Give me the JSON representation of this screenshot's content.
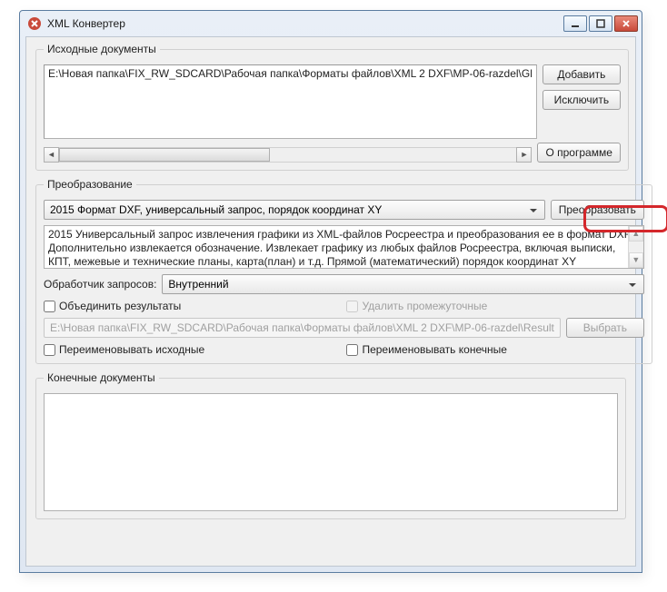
{
  "window": {
    "title": "XML Конвертер"
  },
  "source": {
    "legend": "Исходные документы",
    "path": "E:\\Новая папка\\FIX_RW_SDCARD\\Рабочая папка\\Форматы файлов\\XML 2 DXF\\MP-06-razdel\\Gl",
    "add": "Добавить",
    "remove": "Исключить",
    "about": "О программе"
  },
  "transform": {
    "legend": "Преобразование",
    "format": "2015 Формат DXF, универсальный запрос, порядок координат XY",
    "convert": "Преобразовать",
    "desc": "2015 Универсальный запрос извлечения графики из XML-файлов Росреестра и преобразования ее в формат DXF. Дополнительно извлекается обозначение. Извлекает графику из любых файлов Росреестра, включая выписки, КПТ, межевые и технические планы, карта(план) и т.д. Прямой (математический) порядок координат XY",
    "handler_label": "Обработчик запросов:",
    "handler_value": "Внутренний",
    "merge": "Объединить результаты",
    "delete_temp": "Удалить промежуточные",
    "result_path": "E:\\Новая папка\\FIX_RW_SDCARD\\Рабочая папка\\Форматы файлов\\XML 2 DXF\\MP-06-razdel\\Result",
    "choose": "Выбрать",
    "rename_src": "Переименовывать исходные",
    "rename_dst": "Переименовывать конечные"
  },
  "output": {
    "legend": "Конечные документы"
  }
}
